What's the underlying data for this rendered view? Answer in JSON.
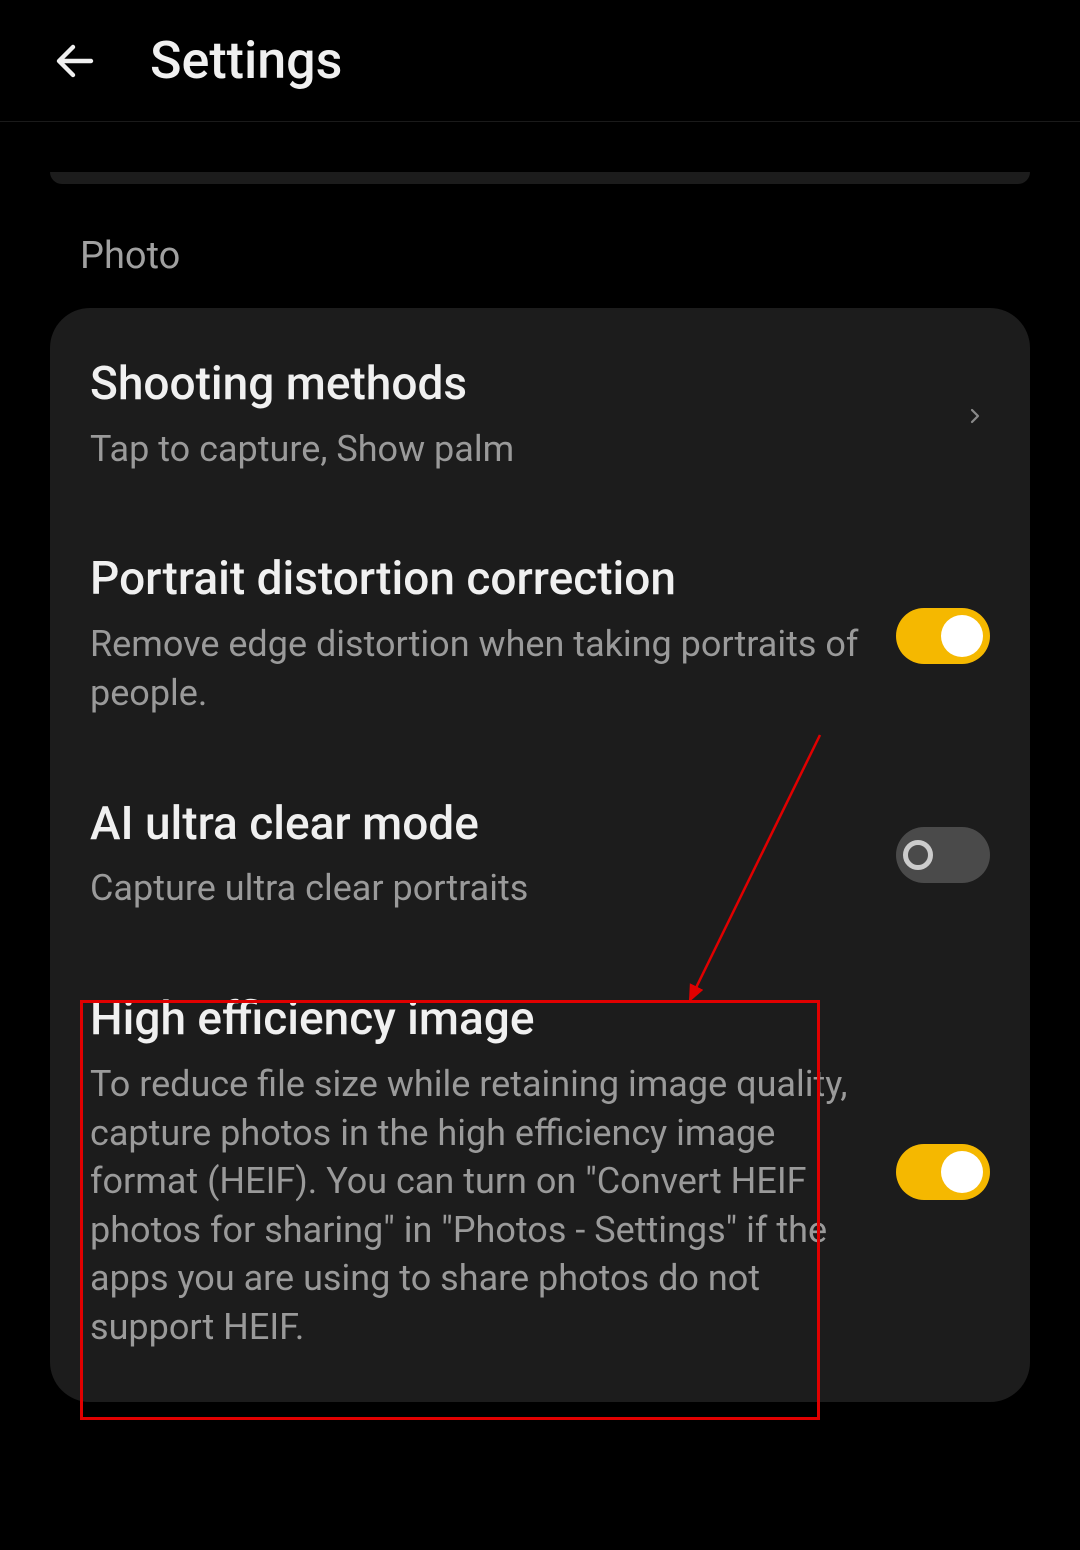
{
  "header": {
    "title": "Settings"
  },
  "section": {
    "label": "Photo"
  },
  "items": [
    {
      "title": "Shooting methods",
      "subtitle": "Tap to capture, Show palm",
      "control": "chevron"
    },
    {
      "title": "Portrait distortion correction",
      "subtitle": "Remove edge distortion when taking portraits of people.",
      "control": "toggle",
      "state": "on"
    },
    {
      "title": "AI ultra clear mode",
      "subtitle": "Capture ultra clear portraits",
      "control": "toggle",
      "state": "off"
    },
    {
      "title": "High efficiency image",
      "subtitle": "To reduce file size while retaining image quality, capture photos in the high efficiency image format (HEIF). You can turn on \"Convert HEIF photos for sharing\" in \"Photos - Settings\" if the apps you are using to share photos do not support HEIF.",
      "control": "toggle",
      "state": "on"
    }
  ],
  "annotations": {
    "highlight_target": "High efficiency image"
  }
}
